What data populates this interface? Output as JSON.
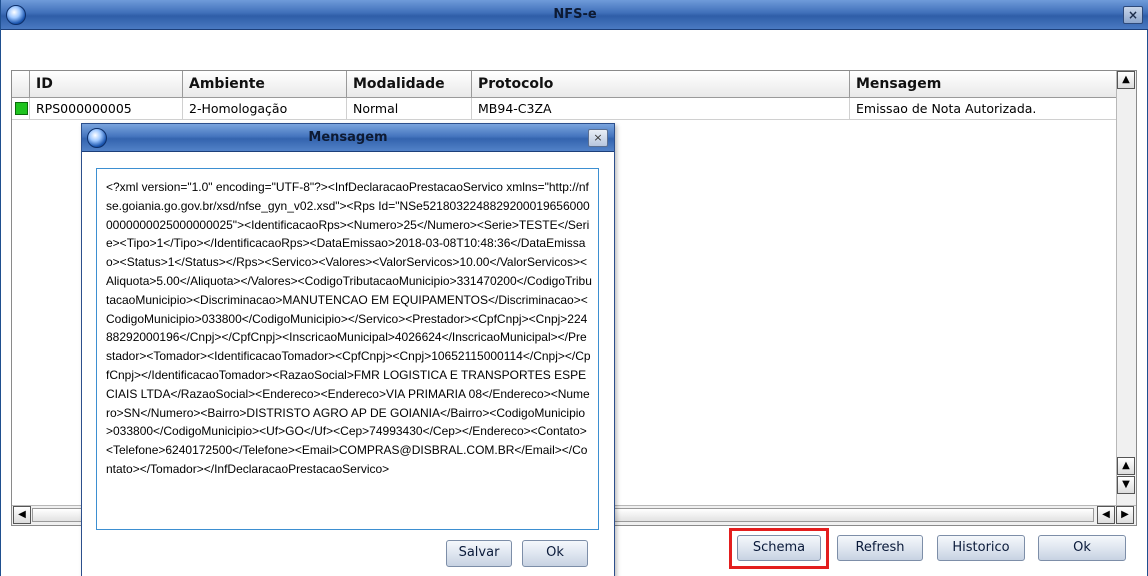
{
  "window": {
    "title": "NFS-e",
    "close_label": "×"
  },
  "grid": {
    "columns": [
      "ID",
      "Ambiente",
      "Modalidade",
      "Protocolo",
      "Mensagem"
    ],
    "rows": [
      {
        "status_color": "#1fc31f",
        "id": "RPS000000005",
        "ambiente": "2-Homologação",
        "modalidade": "Normal",
        "protocolo": "MB94-C3ZA",
        "mensagem": "Emissao de Nota Autorizada."
      }
    ]
  },
  "scroll": {
    "up": "▲",
    "down": "▼",
    "left": "◀",
    "right": "▶"
  },
  "buttons": {
    "schema": "Schema",
    "refresh": "Refresh",
    "historico": "Historico",
    "ok": "Ok"
  },
  "highlight_color": "#e31e1e",
  "dialog": {
    "title": "Mensagem",
    "close_label": "×",
    "content": "<?xml version=\"1.0\" encoding=\"UTF-8\"?><InfDeclaracaoPrestacaoServico xmlns=\"http://nfse.goiania.go.gov.br/xsd/nfse_gyn_v02.xsd\"><Rps Id=\"NSe52180322488292000196560000000000025000000025\"><IdentificacaoRps><Numero>25</Numero><Serie>TESTE</Serie><Tipo>1</Tipo></IdentificacaoRps><DataEmissao>2018-03-08T10:48:36</DataEmissao><Status>1</Status></Rps><Servico><Valores><ValorServicos>10.00</ValorServicos><Aliquota>5.00</Aliquota></Valores><CodigoTributacaoMunicipio>331470200</CodigoTributacaoMunicipio><Discriminacao>MANUTENCAO EM EQUIPAMENTOS</Discriminacao><CodigoMunicipio>033800</CodigoMunicipio></Servico><Prestador><CpfCnpj><Cnpj>22488292000196</Cnpj></CpfCnpj><InscricaoMunicipal>4026624</InscricaoMunicipal></Prestador><Tomador><IdentificacaoTomador><CpfCnpj><Cnpj>10652115000114</Cnpj></CpfCnpj></IdentificacaoTomador><RazaoSocial>FMR LOGISTICA E TRANSPORTES ESPECIAIS LTDA</RazaoSocial><Endereco><Endereco>VIA PRIMARIA 08</Endereco><Numero>SN</Numero><Bairro>DISTRISTO AGRO AP DE GOIANIA</Bairro><CodigoMunicipio>033800</CodigoMunicipio><Uf>GO</Uf><Cep>74993430</Cep></Endereco><Contato><Telefone>6240172500</Telefone><Email>COMPRAS@DISBRAL.COM.BR</Email></Contato></Tomador></InfDeclaracaoPrestacaoServico>",
    "salvar_label": "Salvar",
    "ok_label": "Ok"
  }
}
